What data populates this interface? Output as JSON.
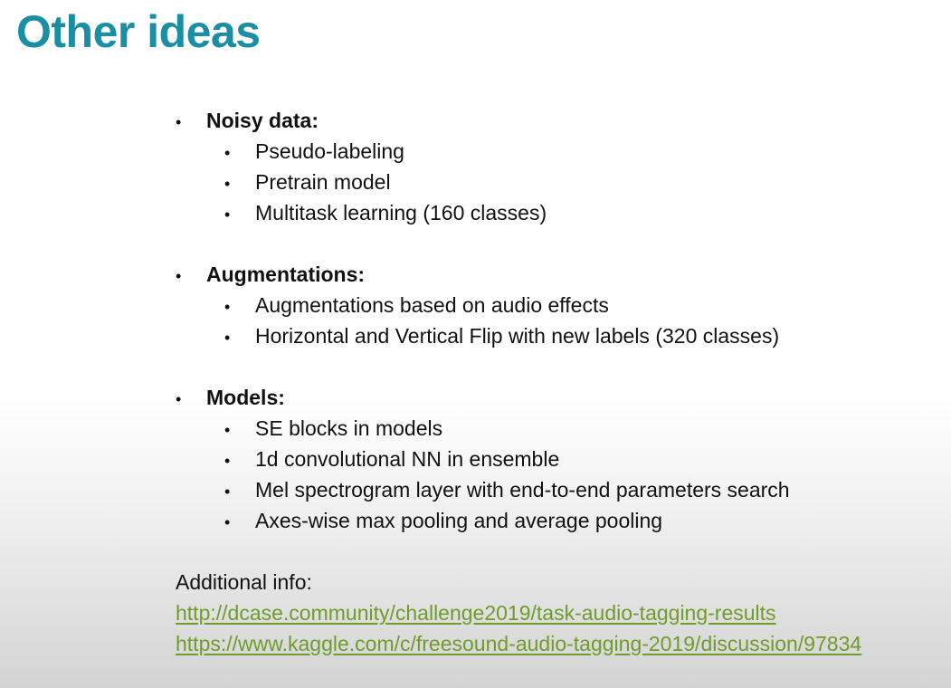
{
  "slide": {
    "title": "Other ideas",
    "sections": [
      {
        "heading": "Noisy data:",
        "items": [
          "Pseudo-labeling",
          "Pretrain model",
          "Multitask learning (160 classes)"
        ]
      },
      {
        "heading": "Augmentations:",
        "items": [
          "Augmentations based on audio effects",
          "Horizontal and Vertical Flip with new labels (320 classes)"
        ]
      },
      {
        "heading": "Models:",
        "items": [
          "SE blocks in models",
          "1d convolutional NN in ensemble",
          "Mel spectrogram layer with end-to-end parameters search",
          "Axes-wise max pooling and average pooling"
        ]
      }
    ],
    "bullet_char": "•",
    "additional_info": {
      "label": "Additional info:",
      "links": [
        "http://dcase.community/challenge2019/task-audio-tagging-results",
        "https://www.kaggle.com/c/freesound-audio-tagging-2019/discussion/97834"
      ]
    },
    "colors": {
      "title": "#1a8ea3",
      "link": "#6f9c2b",
      "text": "#111111"
    }
  }
}
